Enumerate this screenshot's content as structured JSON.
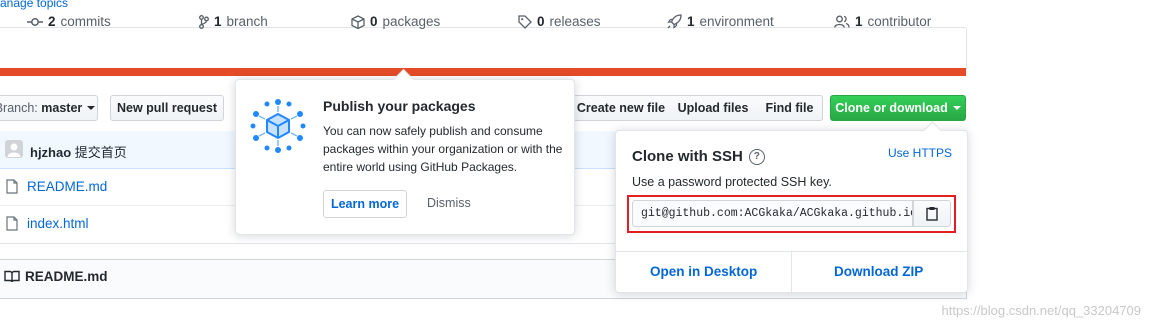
{
  "manage_topics": "anage topics",
  "summary": {
    "commits": {
      "count": "2",
      "label": "commits"
    },
    "branch": {
      "count": "1",
      "label": "branch"
    },
    "packages": {
      "count": "0",
      "label": "packages"
    },
    "releases": {
      "count": "0",
      "label": "releases"
    },
    "environment": {
      "count": "1",
      "label": "environment"
    },
    "contributor": {
      "count": "1",
      "label": "contributor"
    }
  },
  "language_bar_color": "#e34c26",
  "toolbar": {
    "branch_prefix": "Branch:",
    "branch_value": "master",
    "new_pull_request": "New pull request",
    "create_new_file": "Create new file",
    "upload_files": "Upload files",
    "find_file": "Find file",
    "clone_or_download": "Clone or download"
  },
  "latest_commit": {
    "author": "hjzhao",
    "message": "提交首页"
  },
  "files": [
    {
      "name": "README.md",
      "icon": "file-icon"
    },
    {
      "name": "index.html",
      "icon": "file-icon"
    }
  ],
  "readme": {
    "title": "README.md",
    "icon": "book-icon"
  },
  "publish_popover": {
    "title": "Publish your packages",
    "body": "You can now safely publish and consume packages within your organization or with the entire world using GitHub Packages.",
    "learn_more": "Learn more",
    "dismiss": "Dismiss",
    "illustration": "packages-cube-illustration"
  },
  "clone_dropdown": {
    "title": "Clone with SSH",
    "use_https": "Use HTTPS",
    "subtitle": "Use a password protected SSH key.",
    "ssh_url": "git@github.com:ACGkaka/ACGkaka.github.io.git",
    "copy_icon": "clipboard-icon",
    "open_in_desktop": "Open in Desktop",
    "download_zip": "Download ZIP",
    "highlight_color": "#e31e24"
  },
  "watermark": "https://blog.csdn.net/qq_33204709",
  "colors": {
    "link": "#0366d6",
    "green": "#28a745",
    "text": "#24292e",
    "muted": "#586069"
  }
}
